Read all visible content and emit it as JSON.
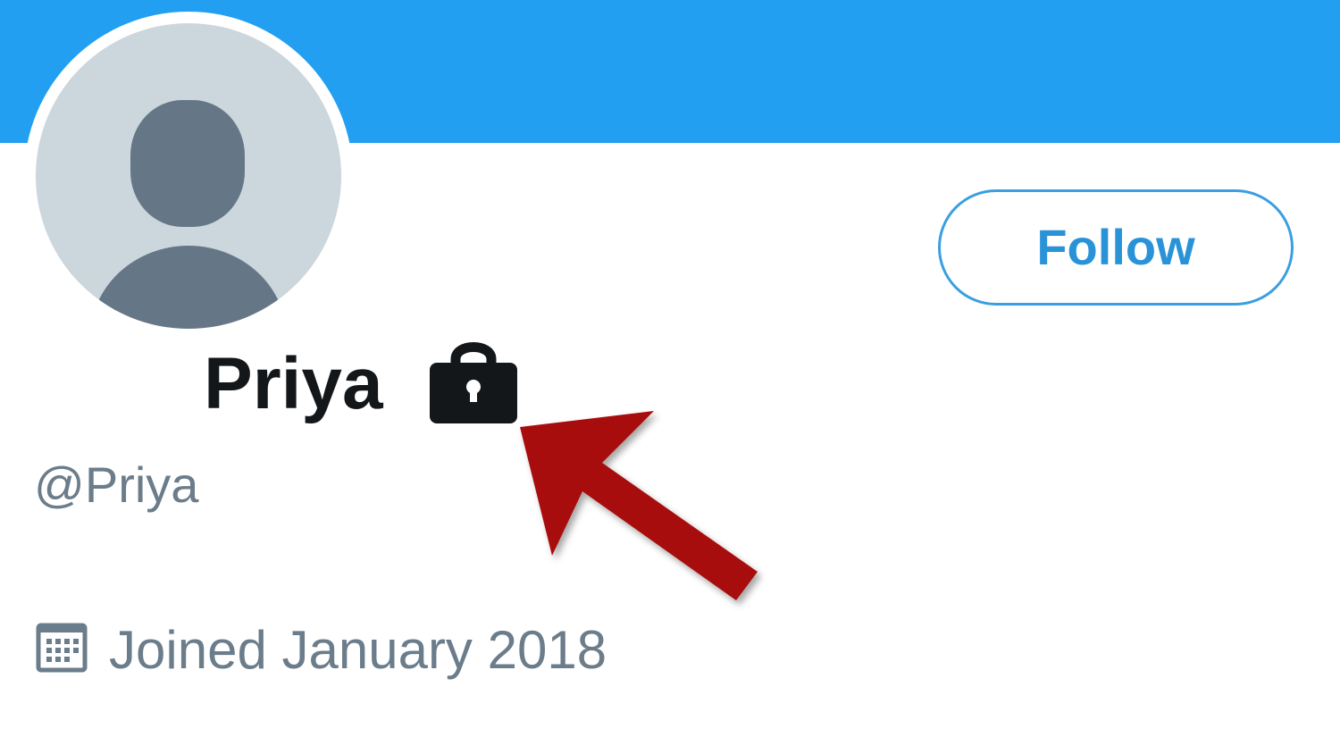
{
  "profile": {
    "display_name": "Priya",
    "handle": "@Priya",
    "joined": "Joined January 2018",
    "follow_label": "Follow",
    "protected": true
  },
  "icons": {
    "avatar": "default-avatar-icon",
    "lock": "lock-icon",
    "calendar": "calendar-icon",
    "annotation": "red-arrow-icon"
  },
  "colors": {
    "banner": "#229ff0",
    "accent": "#2a93d8",
    "name": "#14171a",
    "secondary_text": "#6b7c8b",
    "annotation_arrow": "#a8090a"
  }
}
